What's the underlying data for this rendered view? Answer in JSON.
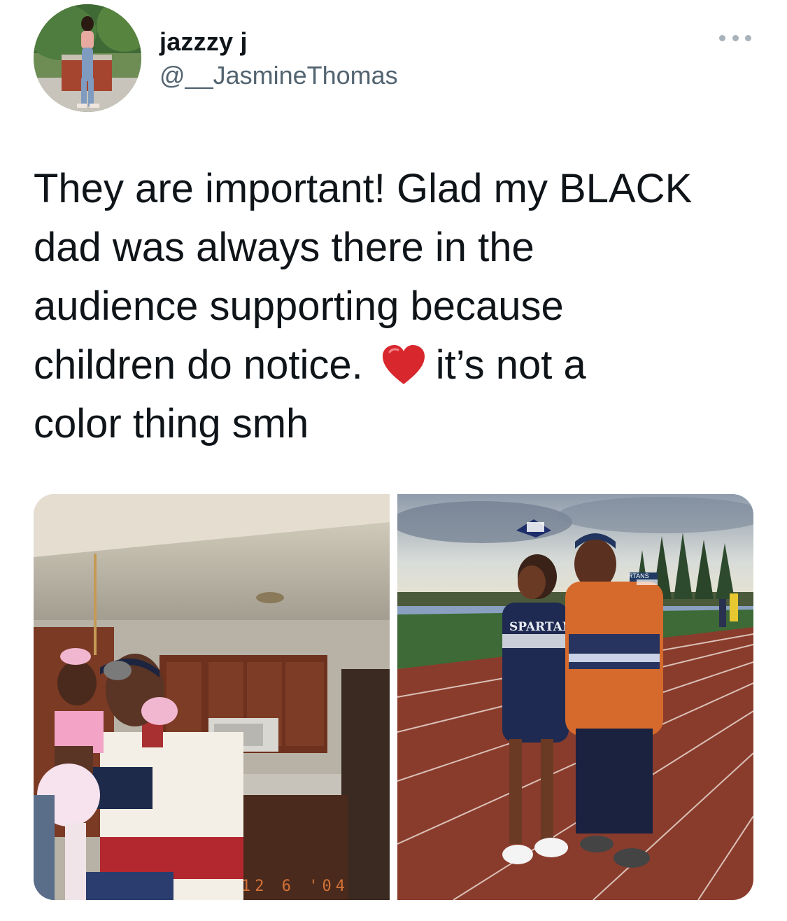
{
  "tweet": {
    "author": {
      "display_name": "jazzzy j",
      "handle": "@__JasmineThomas",
      "avatar_icon": "profile-photo"
    },
    "more_icon": "more-options-icon",
    "text_lines": [
      "They are important! Glad my BLACK",
      "dad was always there in the",
      "audience supporting because",
      "children do notice.",
      "it’s not a",
      "color thing smh"
    ],
    "emoji": "❤️",
    "media": {
      "photo_left": {
        "description_icon": "kitchen-photo",
        "date_stamp": "12  6 '04"
      },
      "photo_right": {
        "description_icon": "track-field-photo",
        "uniform_text": "SPARTAN",
        "scoreboard_text": "RTANS"
      }
    }
  },
  "colors": {
    "text": "#0f1419",
    "secondary_text": "#536471",
    "heart": "#d9272e"
  }
}
